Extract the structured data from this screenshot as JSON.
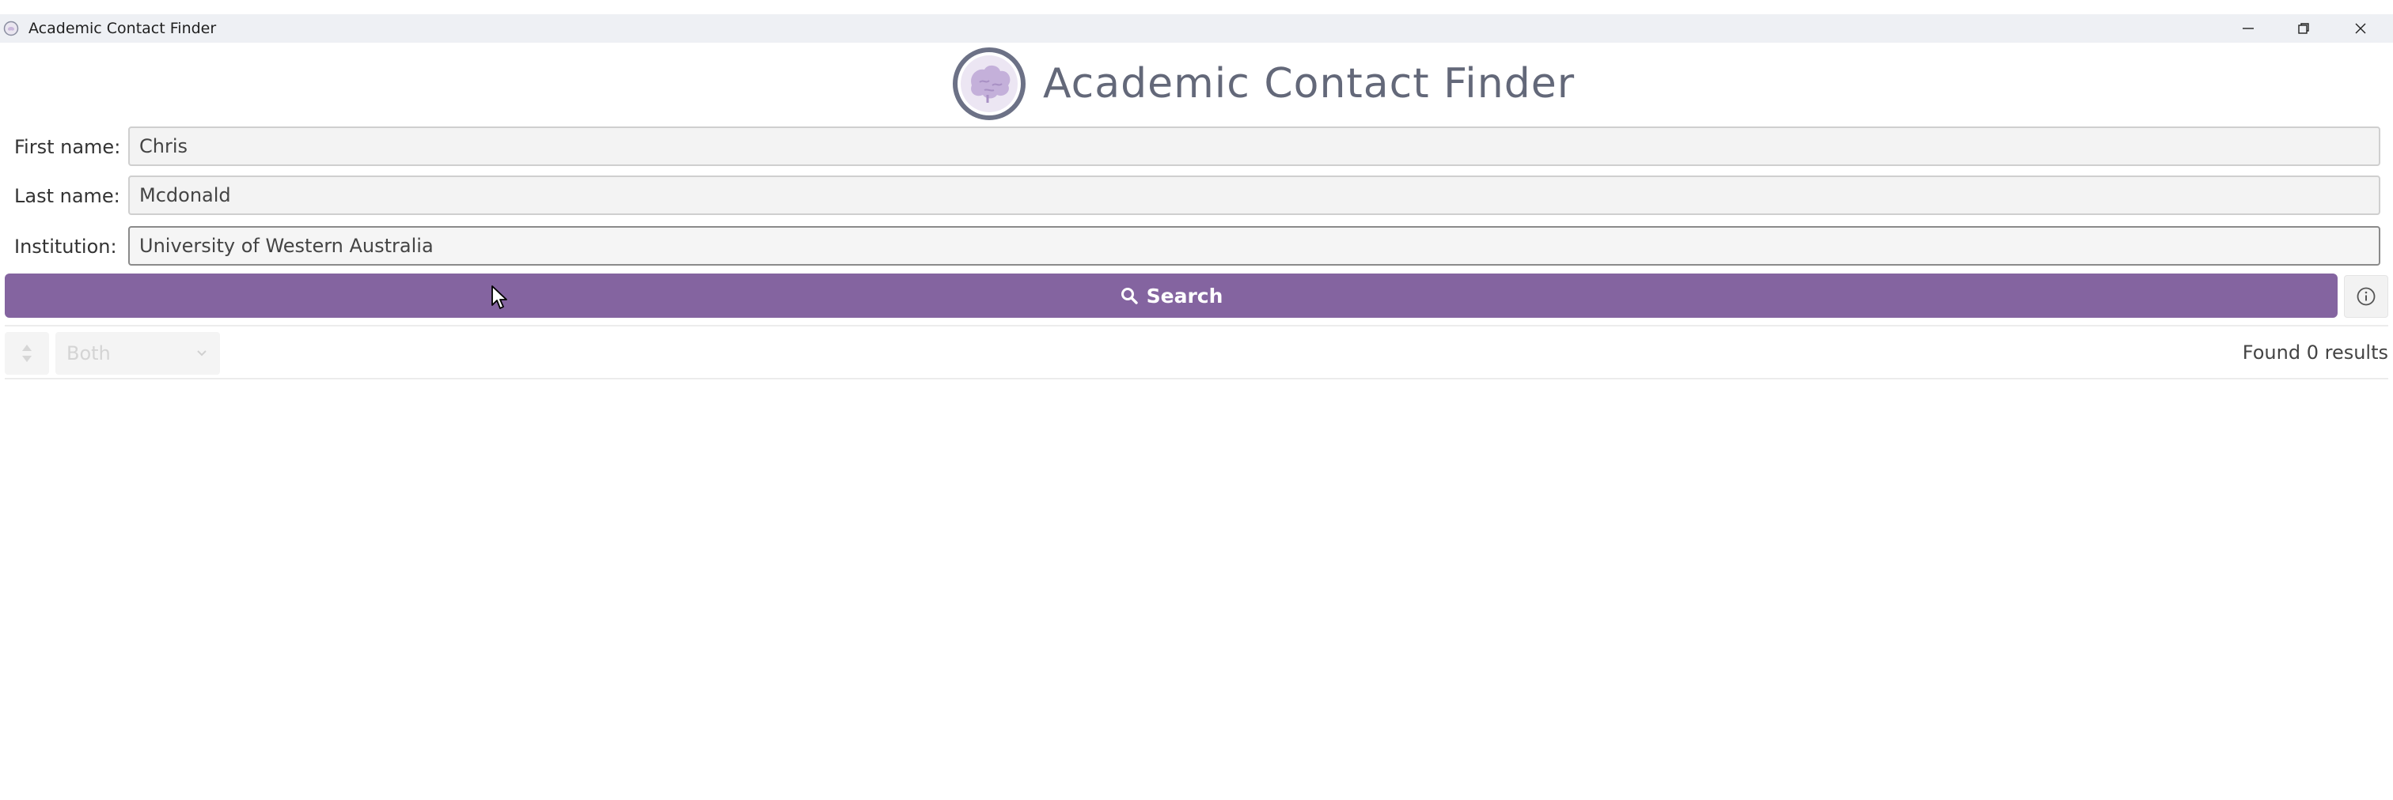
{
  "window": {
    "title": "Academic Contact Finder",
    "controls": [
      "minimize-icon",
      "restore-icon",
      "close-icon"
    ]
  },
  "header": {
    "app_title": "Academic Contact Finder",
    "logo_icon": "brain-icon"
  },
  "form": {
    "first_name": {
      "label": "First name:",
      "value": "Chris"
    },
    "last_name": {
      "label": "Last name:",
      "value": "Mcdonald"
    },
    "institution": {
      "label": "Institution:",
      "value": "University of Western Australia"
    }
  },
  "search": {
    "label": "Search",
    "icon": "search-icon",
    "info_icon": "info-icon"
  },
  "toolbar": {
    "sort_icon": "sort-icon",
    "filter_selected": "Both",
    "results_text": "Found 0 results"
  },
  "colors": {
    "accent": "#8464a0",
    "title_text": "#636879",
    "titlebar_bg": "#eef0f4"
  }
}
